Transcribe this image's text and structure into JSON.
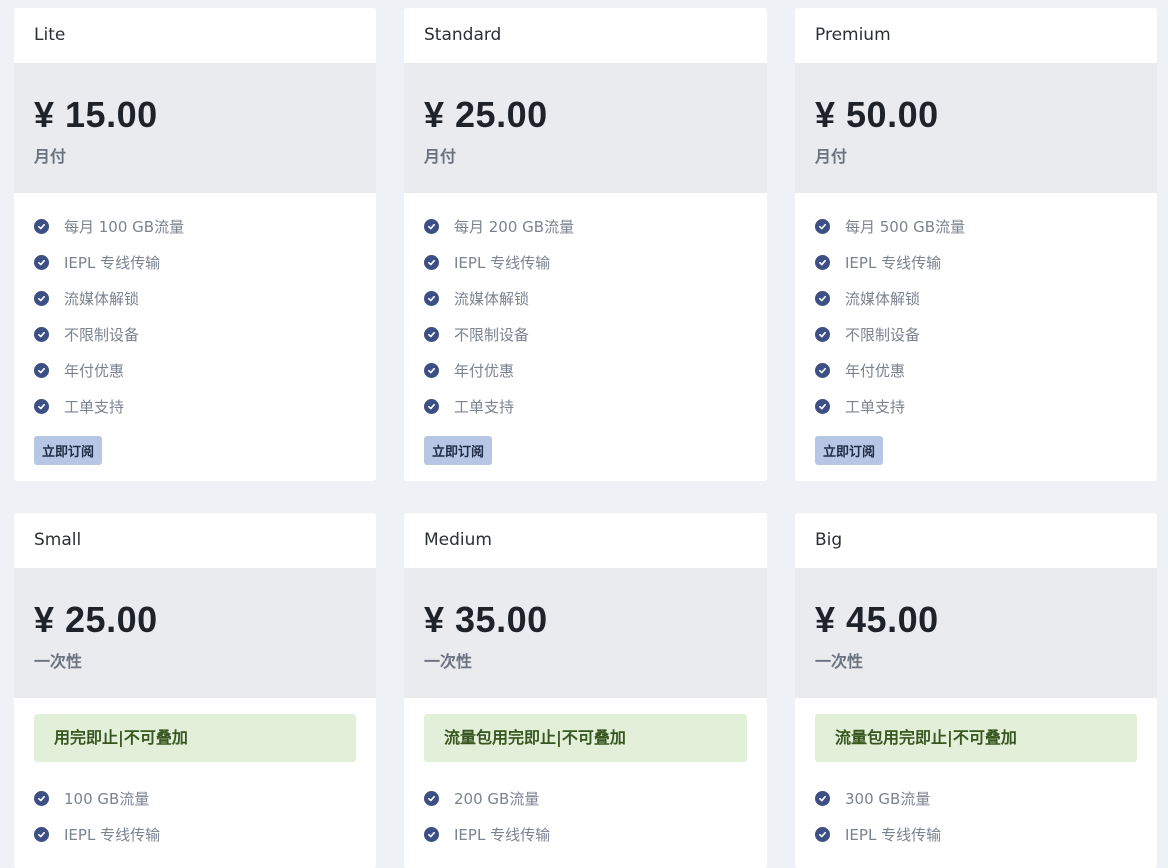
{
  "colors": {
    "page_bg": "#eef1f6",
    "price_bg": "#e9ebef",
    "check": "#3d5085",
    "button_bg": "#b7c6e4",
    "notice_bg": "#e2efd9",
    "notice_text": "#38561f"
  },
  "icons": {
    "feature": "check-circle-icon"
  },
  "plans": [
    {
      "name": "Lite",
      "price": "¥ 15.00",
      "period": "月付",
      "features": [
        "每月 100 GB流量",
        "IEPL 专线传输",
        "流媒体解锁",
        "不限制设备",
        "年付优惠",
        "工单支持"
      ],
      "button_label": "立即订阅"
    },
    {
      "name": "Standard",
      "price": "¥ 25.00",
      "period": "月付",
      "features": [
        "每月 200 GB流量",
        "IEPL 专线传输",
        "流媒体解锁",
        "不限制设备",
        "年付优惠",
        "工单支持"
      ],
      "button_label": "立即订阅"
    },
    {
      "name": "Premium",
      "price": "¥ 50.00",
      "period": "月付",
      "features": [
        "每月 500 GB流量",
        "IEPL 专线传输",
        "流媒体解锁",
        "不限制设备",
        "年付优惠",
        "工单支持"
      ],
      "button_label": "立即订阅"
    },
    {
      "name": "Small",
      "price": "¥ 25.00",
      "period": "一次性",
      "notice": "用完即止|不可叠加",
      "features": [
        "100 GB流量",
        "IEPL 专线传输"
      ]
    },
    {
      "name": "Medium",
      "price": "¥ 35.00",
      "period": "一次性",
      "notice": "流量包用完即止|不可叠加",
      "features": [
        "200 GB流量",
        "IEPL 专线传输"
      ]
    },
    {
      "name": "Big",
      "price": "¥ 45.00",
      "period": "一次性",
      "notice": "流量包用完即止|不可叠加",
      "features": [
        "300 GB流量",
        "IEPL 专线传输"
      ]
    }
  ]
}
